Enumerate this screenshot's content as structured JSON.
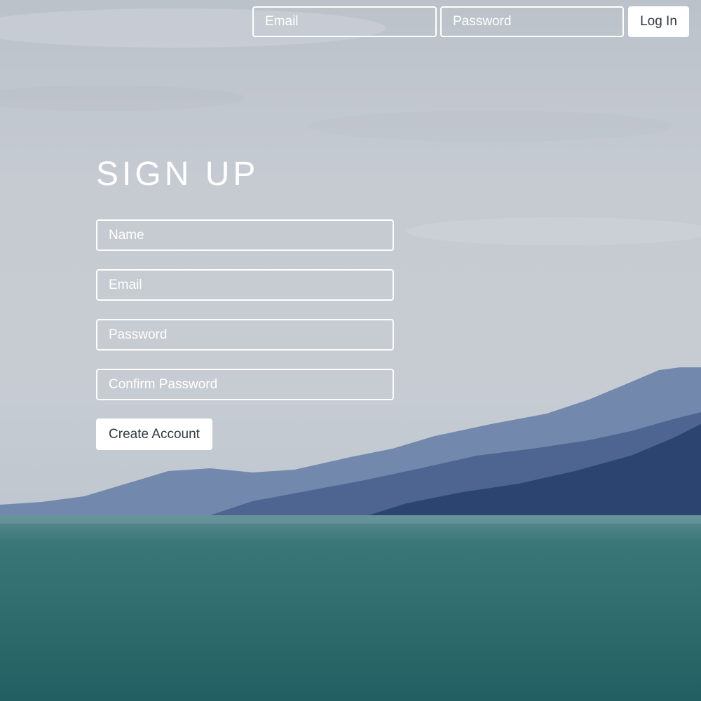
{
  "header": {
    "email_placeholder": "Email",
    "password_placeholder": "Password",
    "login_label": "Log In"
  },
  "signup": {
    "title": "SIGN UP",
    "name_placeholder": "Name",
    "email_placeholder": "Email",
    "password_placeholder": "Password",
    "confirm_password_placeholder": "Confirm Password",
    "create_account_label": "Create Account"
  },
  "colors": {
    "sky": "#c4c9d0",
    "mountains": "#3d5a8a",
    "sea": "#2f6e70",
    "button_bg": "#ffffff",
    "button_text": "#333a40"
  }
}
